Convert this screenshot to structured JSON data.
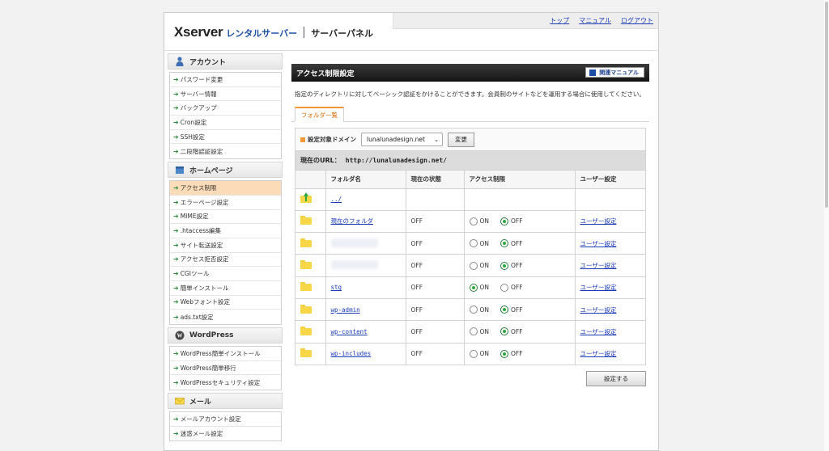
{
  "header": {
    "logo_brand": "Xserver",
    "logo_product": "レンタルサーバー",
    "logo_panel": "サーバーパネル",
    "links": [
      "トップ",
      "マニュアル",
      "ログアウト"
    ]
  },
  "sidebar": {
    "sections": [
      {
        "title": "アカウント",
        "icon": "user-icon",
        "items": [
          "パスワード変更",
          "サーバー情報",
          "バックアップ",
          "Cron設定",
          "SSH設定",
          "二段階認証設定"
        ]
      },
      {
        "title": "ホームページ",
        "icon": "homepage-icon",
        "items": [
          "アクセス制限",
          "エラーページ設定",
          "MIME設定",
          ".htaccess編集",
          "サイト転送設定",
          "アクセス拒否設定",
          "CGIツール",
          "簡単インストール",
          "Webフォント設定",
          "ads.txt設定"
        ]
      },
      {
        "title": "WordPress",
        "icon": "wordpress-icon",
        "items": [
          "WordPress簡単インストール",
          "WordPress簡単移行",
          "WordPressセキュリティ設定"
        ]
      },
      {
        "title": "メール",
        "icon": "mail-icon",
        "items": [
          "メールアカウント設定",
          "迷惑メール設定"
        ]
      }
    ],
    "active_item": "アクセス制限"
  },
  "main": {
    "title": "アクセス制限設定",
    "manual_button": "関連マニュアル",
    "description": "指定のディレクトリに対してベーシック認証をかけることができます。会員制のサイトなどを運用する場合に使用してください。",
    "tab": "フォルダ一覧",
    "domain_label": "設定対象ドメイン",
    "domain_value": "lunalunadesign.net",
    "change_button": "変更",
    "url_label": "現在のURL：",
    "url_value": "http://lunalunadesign.net/",
    "columns": [
      "",
      "フォルダ名",
      "現在の状態",
      "アクセス制限",
      "ユーザー設定"
    ],
    "on_label": "ON",
    "off_label": "OFF",
    "rows": [
      {
        "icon": "folder-up-icon",
        "name": "../",
        "state": "",
        "access": null,
        "user": ""
      },
      {
        "icon": "folder-icon",
        "name": "現在のフォルダ",
        "mono": false,
        "state": "OFF",
        "access": "OFF",
        "user": "ユーザー設定"
      },
      {
        "icon": "folder-icon",
        "name": "",
        "redacted": true,
        "state": "OFF",
        "access": "OFF",
        "user": "ユーザー設定"
      },
      {
        "icon": "folder-icon",
        "name": "",
        "redacted": true,
        "state": "OFF",
        "access": "OFF",
        "user": "ユーザー設定"
      },
      {
        "icon": "folder-icon",
        "name": "stg",
        "mono": true,
        "state": "OFF",
        "access": "ON",
        "user": "ユーザー設定"
      },
      {
        "icon": "folder-icon",
        "name": "wp-admin",
        "mono": true,
        "state": "OFF",
        "access": "OFF",
        "user": "ユーザー設定"
      },
      {
        "icon": "folder-icon",
        "name": "wp-content",
        "mono": true,
        "state": "OFF",
        "access": "OFF",
        "user": "ユーザー設定"
      },
      {
        "icon": "folder-icon",
        "name": "wp-includes",
        "mono": true,
        "state": "OFF",
        "access": "OFF",
        "user": "ユーザー設定"
      }
    ],
    "submit_button": "設定する"
  },
  "colors": {
    "accent": "#f19a35",
    "link": "#1a3ab8",
    "brand": "#1d4ea3",
    "active_item_bg": "#fcdcb8",
    "radio_on": "#2ea83a"
  }
}
